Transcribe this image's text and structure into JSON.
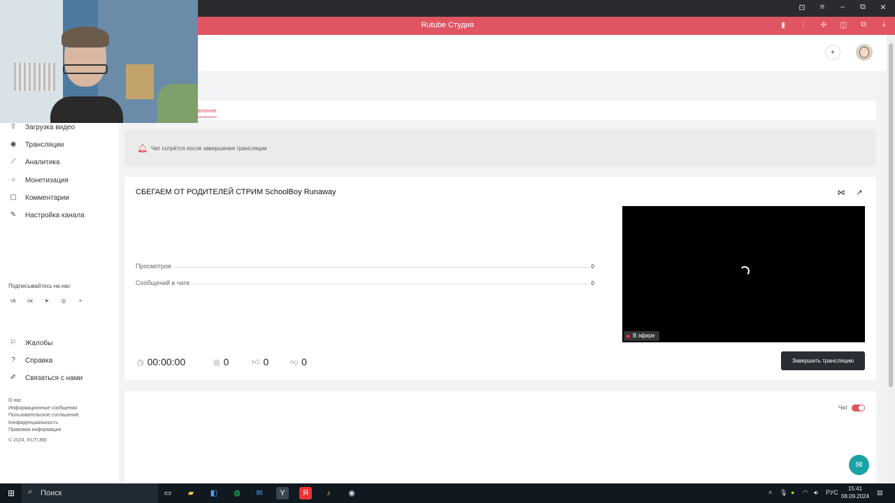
{
  "browser": {
    "title": "Rutube Студия",
    "accent": "#e05562"
  },
  "sidebar": {
    "items": [
      {
        "label": "Загрузка видео",
        "icon": "upload-icon"
      },
      {
        "label": "Трансляции",
        "icon": "broadcast-icon"
      },
      {
        "label": "Аналитика",
        "icon": "analytics-icon"
      },
      {
        "label": "Монетизация",
        "icon": "money-icon"
      },
      {
        "label": "Комментарии",
        "icon": "comment-icon"
      },
      {
        "label": "Настройка канала",
        "icon": "settings-wand-icon"
      }
    ],
    "subscribe_label": "Подписывайтесь на нас",
    "socials": [
      "vk-icon",
      "ok-icon",
      "telegram-icon",
      "viber-icon",
      "plus-icon"
    ],
    "support_items": [
      {
        "label": "Жалобы",
        "icon": "flag-icon"
      },
      {
        "label": "Справка",
        "icon": "help-icon"
      },
      {
        "label": "Связаться с нами",
        "icon": "contact-icon"
      }
    ],
    "footer_links": [
      "О нас",
      "Информационные сообщения",
      "Пользовательское соглашение",
      "Конфиденциальность",
      "Правовая информация"
    ],
    "copyright": "© 2024, RUTUBE"
  },
  "tabs": {
    "active_partial": "вление"
  },
  "notice": {
    "text": "Чат сотрётся после завершения трансляции"
  },
  "stream": {
    "title": "СБЕГАЕМ ОТ РОДИТЕЛЕЙ СТРИМ SchoolBoy Runaway",
    "stats": [
      {
        "label": "Просмотров",
        "value": "0"
      },
      {
        "label": "Сообщений в чате",
        "value": "0"
      }
    ],
    "live_label": "В эфире",
    "duration": "00:00:00",
    "viewers": "0",
    "likes": "0",
    "dislikes": "0",
    "end_button": "Завершить трансляцию"
  },
  "chat": {
    "label": "Чат",
    "enabled": true
  },
  "taskbar": {
    "search_label": "Поиск",
    "lang": "РУС",
    "time": "15:41",
    "date": "08.09.2024"
  }
}
